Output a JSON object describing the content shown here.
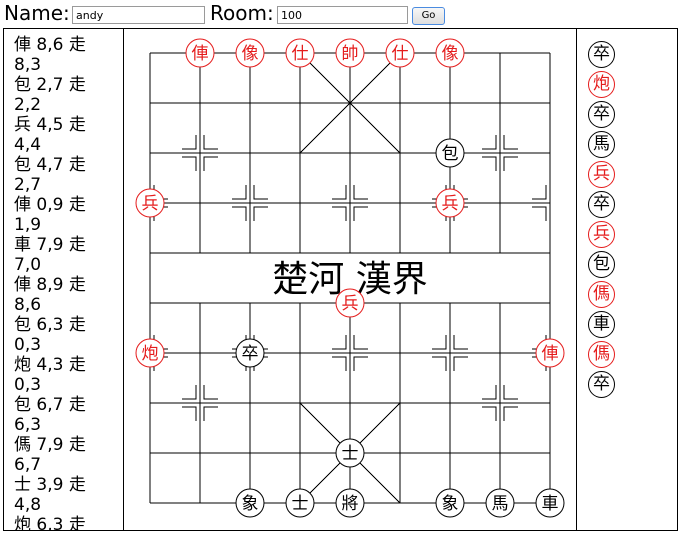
{
  "header": {
    "name_label": "Name:",
    "name_value": "andy",
    "room_label": "Room:",
    "room_value": "100",
    "go_label": "Go"
  },
  "move_log": [
    "俥 8,6 走 8,3",
    "包 2,7 走 2,2",
    "兵 4,5 走 4,4",
    "包 4,7 走 2,7",
    "俥 0,9 走 1,9",
    "車 7,9 走 7,0",
    "俥 8,9 走 8,6",
    "包 6,3 走 0,3",
    "炮 4,3 走 0,3",
    "包 6,7 走 6,3",
    "傌 7,9 走 6,7",
    "士 3,9 走 4,8",
    "炮 6,3 走"
  ],
  "board": {
    "river_text": "楚河 漢界",
    "colors": {
      "red": "#e51c1c",
      "black": "#000000"
    },
    "pieces": [
      {
        "ch": "俥",
        "color": "red",
        "col": 1,
        "row": 0
      },
      {
        "ch": "像",
        "color": "red",
        "col": 2,
        "row": 0
      },
      {
        "ch": "仕",
        "color": "red",
        "col": 3,
        "row": 0
      },
      {
        "ch": "帥",
        "color": "red",
        "col": 4,
        "row": 0
      },
      {
        "ch": "仕",
        "color": "red",
        "col": 5,
        "row": 0
      },
      {
        "ch": "像",
        "color": "red",
        "col": 6,
        "row": 0
      },
      {
        "ch": "包",
        "color": "black",
        "col": 6,
        "row": 2
      },
      {
        "ch": "兵",
        "color": "red",
        "col": 0,
        "row": 3
      },
      {
        "ch": "兵",
        "color": "red",
        "col": 6,
        "row": 3
      },
      {
        "ch": "兵",
        "color": "red",
        "col": 4,
        "row": 5
      },
      {
        "ch": "炮",
        "color": "red",
        "col": 0,
        "row": 6
      },
      {
        "ch": "卒",
        "color": "black",
        "col": 2,
        "row": 6
      },
      {
        "ch": "俥",
        "color": "red",
        "col": 8,
        "row": 6
      },
      {
        "ch": "士",
        "color": "black",
        "col": 4,
        "row": 8
      },
      {
        "ch": "象",
        "color": "black",
        "col": 2,
        "row": 9
      },
      {
        "ch": "士",
        "color": "black",
        "col": 3,
        "row": 9
      },
      {
        "ch": "將",
        "color": "black",
        "col": 4,
        "row": 9
      },
      {
        "ch": "象",
        "color": "black",
        "col": 6,
        "row": 9
      },
      {
        "ch": "馬",
        "color": "black",
        "col": 7,
        "row": 9
      },
      {
        "ch": "車",
        "color": "black",
        "col": 8,
        "row": 9
      }
    ]
  },
  "captured": [
    {
      "ch": "卒",
      "color": "black"
    },
    {
      "ch": "炮",
      "color": "red"
    },
    {
      "ch": "卒",
      "color": "black"
    },
    {
      "ch": "馬",
      "color": "black"
    },
    {
      "ch": "兵",
      "color": "red"
    },
    {
      "ch": "卒",
      "color": "black"
    },
    {
      "ch": "兵",
      "color": "red"
    },
    {
      "ch": "包",
      "color": "black"
    },
    {
      "ch": "傌",
      "color": "red"
    },
    {
      "ch": "車",
      "color": "black"
    },
    {
      "ch": "傌",
      "color": "red"
    },
    {
      "ch": "卒",
      "color": "black"
    }
  ]
}
